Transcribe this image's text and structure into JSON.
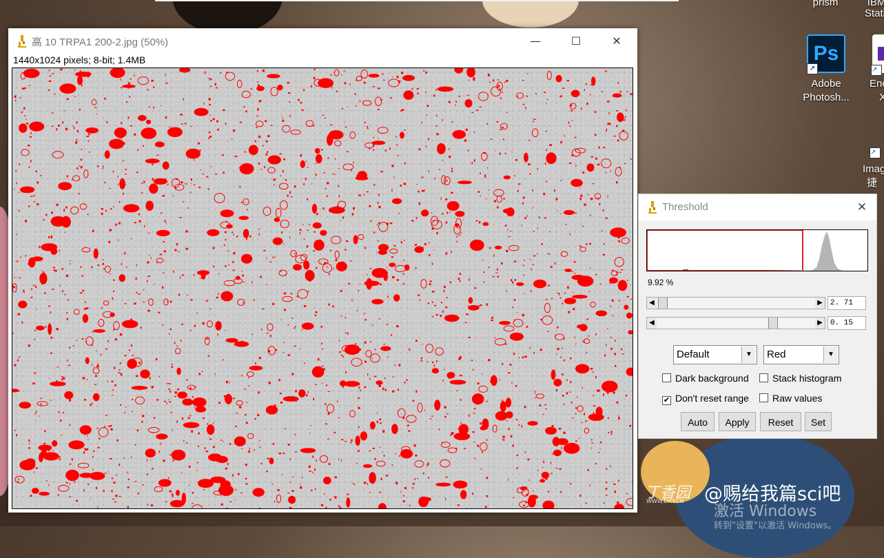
{
  "desktop": {
    "top_labels": [
      "prism",
      "IBM",
      "Stati"
    ],
    "icons": [
      {
        "label1": "Adobe",
        "label2": "Photosh...",
        "tile": "Ps"
      },
      {
        "label1": "Enc",
        "label2": "X"
      },
      {
        "label1": "Imag",
        "label2": "捷"
      }
    ]
  },
  "image_window": {
    "title": "高 10 TRPA1 200-2.jpg (50%)",
    "info": "1440x1024 pixels; 8-bit; 1.4MB",
    "controls": {
      "minimize": "—",
      "maximize": "☐",
      "close": "✕"
    }
  },
  "threshold": {
    "title": "Threshold",
    "close": "✕",
    "percent": "9.92 %",
    "slider1_value": "2. 71",
    "slider2_value": "0. 15",
    "method": "Default",
    "color": "Red",
    "checkboxes": {
      "dark_background": {
        "label": "Dark background",
        "checked": false
      },
      "stack_histogram": {
        "label": "Stack histogram",
        "checked": false
      },
      "dont_reset_range": {
        "label": "Don't reset range",
        "checked": true
      },
      "raw_values": {
        "label": "Raw values",
        "checked": false
      }
    },
    "buttons": {
      "auto": "Auto",
      "apply": "Apply",
      "reset": "Reset",
      "set": "Set"
    },
    "check_glyph": "✔"
  },
  "watermark": {
    "site": "丁香园",
    "site_url": "WWW.DXY.CN",
    "handle": "@赐给我篇sci吧",
    "activate1": "激活 Windows",
    "activate2": "转到\"设置\"以激活 Windows。"
  },
  "colors": {
    "overlay": "#ff0000",
    "ps_blue": "#31a8ff"
  }
}
